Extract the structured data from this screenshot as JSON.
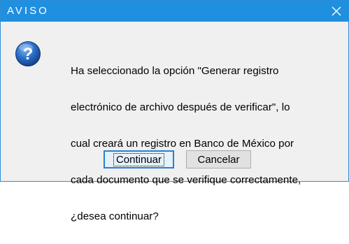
{
  "window": {
    "title": "AVISO",
    "close_glyph": "✕"
  },
  "icon": {
    "name": "question-icon",
    "glyph": "?",
    "color": "#1e5fb4"
  },
  "message": {
    "lines": [
      "Ha seleccionado la opción \"Generar registro",
      "electrónico de archivo después de verificar\", lo",
      "cual creará un registro en Banco de México por",
      "cada documento que se verifique correctamente,",
      "¿desea continuar?"
    ]
  },
  "buttons": {
    "continue_label": "Continuar",
    "cancel_label": "Cancelar"
  },
  "colors": {
    "titlebar": "#1f8fe0",
    "default_button_border": "#2c7fd0"
  }
}
